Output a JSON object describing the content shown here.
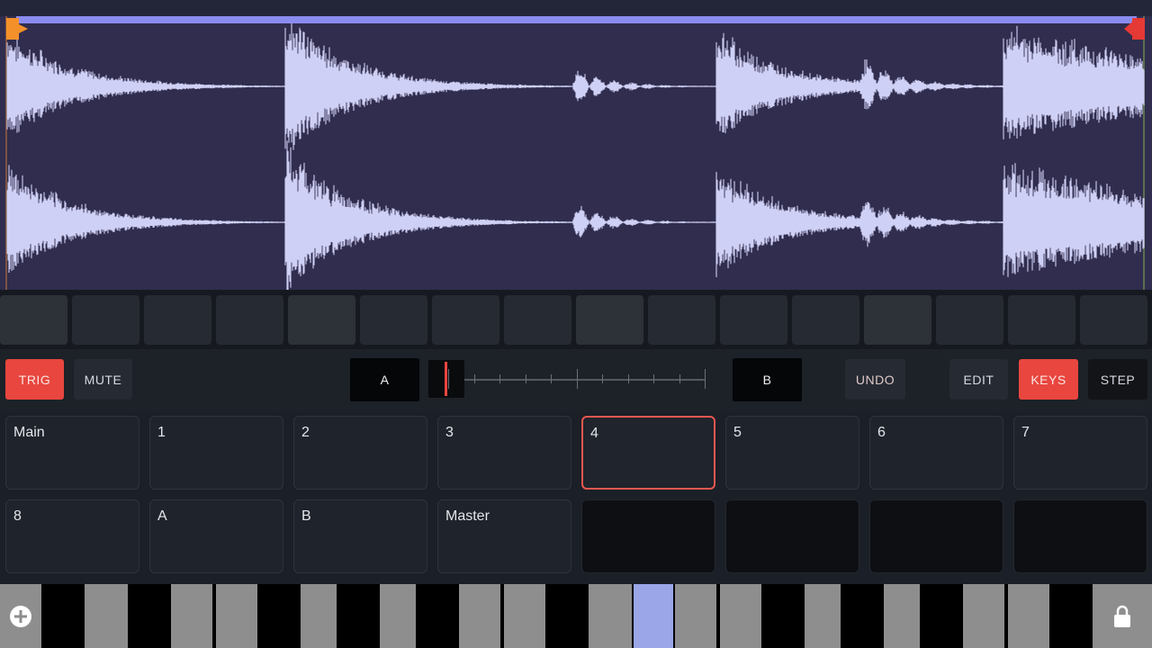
{
  "colors": {
    "accent_red": "#e8463f",
    "waveform": "#cfd0f5",
    "waveform_bg": "#302d4e",
    "loop_bar": "#8a8cf0",
    "start_marker": "#f3902a",
    "end_marker": "#e53935",
    "active_key": "#9aa6e8"
  },
  "controls": {
    "trig_label": "TRIG",
    "mute_label": "MUTE",
    "scene_a_label": "A",
    "scene_b_label": "B",
    "undo_label": "UNDO",
    "edit_label": "EDIT",
    "keys_label": "KEYS",
    "step_label": "STEP",
    "crossfader_position": 0.06
  },
  "pads": [
    {
      "label": "Main"
    },
    {
      "label": "1"
    },
    {
      "label": "2"
    },
    {
      "label": "3"
    },
    {
      "label": "4",
      "selected": true
    },
    {
      "label": "5"
    },
    {
      "label": "6"
    },
    {
      "label": "7"
    },
    {
      "label": "8"
    },
    {
      "label": "A"
    },
    {
      "label": "B"
    },
    {
      "label": "Master"
    },
    {
      "label": ""
    },
    {
      "label": ""
    },
    {
      "label": ""
    },
    {
      "label": ""
    }
  ],
  "icons": {
    "add": "plus-circle-icon",
    "lock": "lock-icon"
  }
}
